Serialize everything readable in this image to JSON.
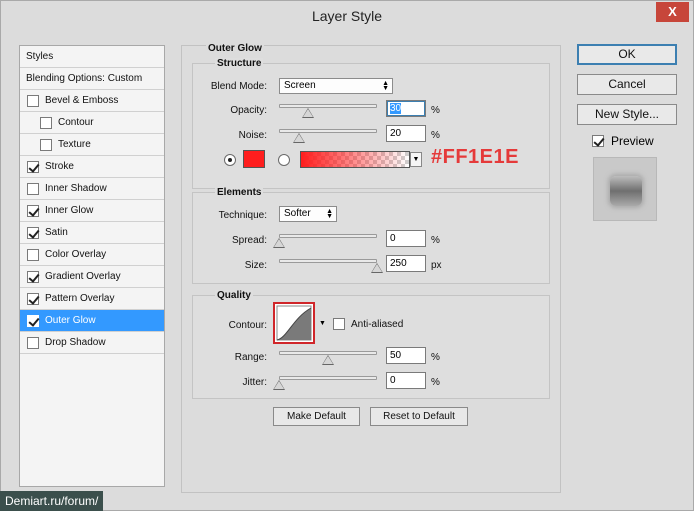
{
  "window": {
    "title": "Layer Style",
    "close_glyph": "X"
  },
  "styles_list": {
    "header": "Styles",
    "blending": "Blending Options: Custom",
    "items": [
      {
        "label": "Bevel & Emboss",
        "checked": false
      },
      {
        "label": "Contour",
        "checked": false
      },
      {
        "label": "Texture",
        "checked": false
      },
      {
        "label": "Stroke",
        "checked": true
      },
      {
        "label": "Inner Shadow",
        "checked": false
      },
      {
        "label": "Inner Glow",
        "checked": true
      },
      {
        "label": "Satin",
        "checked": true
      },
      {
        "label": "Color Overlay",
        "checked": false
      },
      {
        "label": "Gradient Overlay",
        "checked": true
      },
      {
        "label": "Pattern Overlay",
        "checked": true
      },
      {
        "label": "Outer Glow",
        "checked": true
      },
      {
        "label": "Drop Shadow",
        "checked": false
      }
    ]
  },
  "panel": {
    "title": "Outer Glow",
    "structure": {
      "title": "Structure",
      "blend_mode_label": "Blend Mode:",
      "blend_mode_value": "Screen",
      "opacity_label": "Opacity:",
      "opacity_value": "30",
      "opacity_level": 0.3,
      "noise_label": "Noise:",
      "noise_value": "20",
      "noise_level": 0.2,
      "unit_percent": "%",
      "color_hex": "#FF1E1E",
      "color_note": "#FF1E1E"
    },
    "elements": {
      "title": "Elements",
      "technique_label": "Technique:",
      "technique_value": "Softer",
      "spread_label": "Spread:",
      "spread_value": "0",
      "spread_level": 0,
      "size_label": "Size:",
      "size_value": "250",
      "size_level": 1.0,
      "unit_percent": "%",
      "unit_px": "px"
    },
    "quality": {
      "title": "Quality",
      "contour_label": "Contour:",
      "anti_aliased_label": "Anti-aliased",
      "anti_aliased": false,
      "range_label": "Range:",
      "range_value": "50",
      "range_level": 0.5,
      "jitter_label": "Jitter:",
      "jitter_value": "0",
      "jitter_level": 0,
      "unit_percent": "%"
    },
    "make_default": "Make Default",
    "reset_default": "Reset to Default"
  },
  "right": {
    "ok": "OK",
    "cancel": "Cancel",
    "new_style": "New Style...",
    "preview_label": "Preview",
    "preview_checked": true
  },
  "watermark": "Demiart.ru/forum/"
}
